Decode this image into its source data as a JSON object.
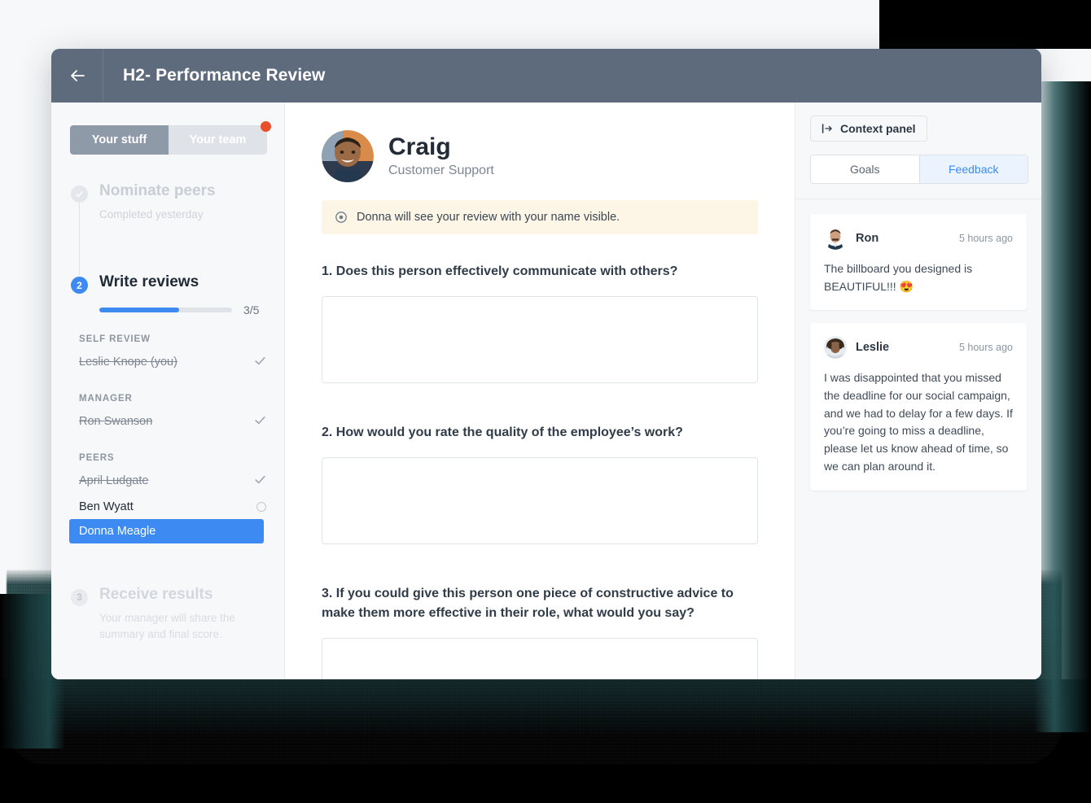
{
  "window": {
    "back_icon": "arrow-left-icon",
    "title": "H2- Performance Review"
  },
  "sidebar": {
    "tabs": [
      {
        "label": "Your stuff",
        "active": true
      },
      {
        "label": "Your team",
        "active": false,
        "has_badge": true
      }
    ],
    "steps": [
      {
        "number": "✓",
        "title": "Nominate peers",
        "subtitle": "Completed yesterday",
        "state": "done"
      },
      {
        "number": "2",
        "title": "Write reviews",
        "state": "current",
        "progress_label": "3/5",
        "progress_done": 3,
        "progress_total": 5
      },
      {
        "number": "3",
        "title": "Receive results",
        "subtitle": "Your manager will share the summary and final score.",
        "state": "future"
      }
    ],
    "groups": [
      {
        "label": "SELF REVIEW",
        "people": [
          {
            "name": "Leslie Knope (you)",
            "status": "complete",
            "selected": false
          }
        ]
      },
      {
        "label": "MANAGER",
        "people": [
          {
            "name": "Ron Swanson",
            "status": "complete",
            "selected": false
          }
        ]
      },
      {
        "label": "PEERS",
        "people": [
          {
            "name": "April Ludgate",
            "status": "complete",
            "selected": false
          },
          {
            "name": "Ben Wyatt",
            "status": "pending",
            "selected": false
          },
          {
            "name": "Donna Meagle",
            "status": "active",
            "selected": true
          }
        ]
      }
    ]
  },
  "main": {
    "person": {
      "name": "Craig",
      "role": "Customer Support",
      "avatar": "craig-avatar"
    },
    "notice": {
      "icon": "eye-icon",
      "text": "Donna will see your review with your name visible."
    },
    "questions": [
      {
        "text": "1. Does this person effectively communicate with others?",
        "answer": "",
        "placeholder": ""
      },
      {
        "text": "2. How would you rate the quality of the employee’s work?",
        "answer": "",
        "placeholder": ""
      },
      {
        "text": "3. If you could give this person one piece of constructive advice to make them more effective in their role, what would you say?",
        "answer": "",
        "placeholder": ""
      }
    ]
  },
  "context_panel": {
    "toggle_label": "Context panel",
    "toggle_icon": "panel-collapse-icon",
    "tabs": [
      {
        "label": "Goals",
        "active": false
      },
      {
        "label": "Feedback",
        "active": true
      }
    ],
    "feedback": [
      {
        "author": "Ron",
        "time": "5 hours ago",
        "body": "The billboard you designed is BEAUTIFUL!!! 😍",
        "avatar": "ron-avatar"
      },
      {
        "author": "Leslie",
        "time": "5 hours ago",
        "body": "I was  disappointed that you missed the deadline for our social campaign, and we had to delay for a few days. If you’re going to miss a deadline, please let us know ahead of time, so we can plan around it.",
        "avatar": "leslie-avatar"
      }
    ]
  },
  "colors": {
    "titlebar": "#5d6b7c",
    "accent_blue": "#3d8bf2",
    "badge_red": "#e8502b",
    "notice_bg": "#fdf6e6",
    "sidebar_bg": "#f7f8fa",
    "shadow_teal": "#1e4648"
  }
}
